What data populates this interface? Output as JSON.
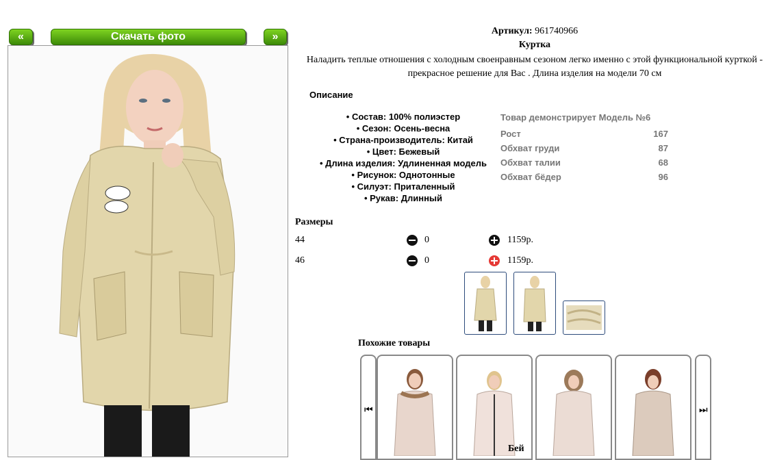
{
  "nav": {
    "prev_label": "«",
    "download_label": "Скачать фото",
    "next_label": "»"
  },
  "product": {
    "article_label": "Артикул:",
    "article_value": "961740966",
    "title": "Куртка",
    "description": "Наладить теплые отношения с холодным своенравным сезоном легко именно с этой функциональной курткой - прекрасное решение для Вас . Длина изделия на модели 70 см"
  },
  "details": {
    "heading": "Описание",
    "properties": [
      "Состав: 100% полиэстер",
      "Сезон: Осень-весна",
      "Страна-производитель: Китай",
      "Цвет: Бежевый",
      "Длина изделия: Удлиненная модель",
      "Рисунок: Однотонные",
      "Силуэт: Приталенный",
      "Рукав: Длинный"
    ]
  },
  "model": {
    "heading": "Товар демонстрирует Модель №6",
    "rows": [
      {
        "label": "Рост",
        "value": "167"
      },
      {
        "label": "Обхват груди",
        "value": "87"
      },
      {
        "label": "Обхват талии",
        "value": "68"
      },
      {
        "label": "Обхват бёдер",
        "value": "96"
      }
    ]
  },
  "sizes": {
    "heading": "Размеры",
    "rows": [
      {
        "size": "44",
        "qty": "0",
        "price": "1159р."
      },
      {
        "size": "46",
        "qty": "0",
        "price": "1159р."
      }
    ]
  },
  "similar": {
    "heading": "Похожие товары",
    "prev_label": "⏮",
    "next_label": "⏭"
  },
  "footer_cut": "Бей",
  "colors": {
    "accent_green": "#5fb312",
    "plus_active": "#e53935",
    "coat": "#e2d6ab"
  }
}
